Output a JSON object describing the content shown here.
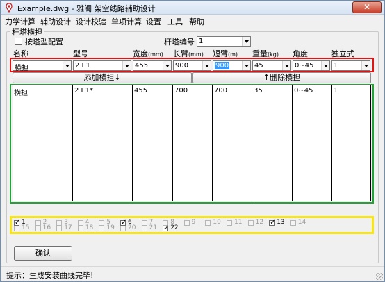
{
  "window": {
    "title": "Example.dwg - 雅阁 架空线路辅助设计",
    "close_label": "✕"
  },
  "menu": [
    "力学计算",
    "辅助设计",
    "设计校验",
    "单项计算",
    "设置",
    "工具",
    "帮助"
  ],
  "group": {
    "title": "杆塔横担",
    "by_tower_checkbox": "按塔型配置",
    "by_tower_checked": false,
    "tower_no_label": "杆塔编号",
    "tower_no_value": "1"
  },
  "columns": {
    "name": "名称",
    "model": "型号",
    "width": "宽度",
    "width_unit": "(mm)",
    "long_arm": "长臂",
    "long_arm_unit": "(mm)",
    "short_arm": "短臂",
    "short_arm_unit": "(m)",
    "weight": "重量",
    "weight_unit": "(kg)",
    "angle": "角度",
    "independent": "独立式"
  },
  "inputs": {
    "name": "横担",
    "model": "2 I 1",
    "width": "455",
    "long_arm": "900",
    "short_arm": "900",
    "weight": "45",
    "angle": "0~45",
    "independent": "1"
  },
  "buttons": {
    "add": "添加横担↓",
    "delete": "↑删除横担",
    "ok": "确认"
  },
  "table_rows": [
    [
      "横担",
      "2 I 1*",
      "455",
      "700",
      "700",
      "35",
      "0~45",
      "1"
    ]
  ],
  "numbers": [
    {
      "n": "1",
      "checked": true,
      "enabled": true
    },
    {
      "n": "2",
      "checked": false,
      "enabled": false
    },
    {
      "n": "3",
      "checked": false,
      "enabled": false
    },
    {
      "n": "4",
      "checked": false,
      "enabled": false
    },
    {
      "n": "5",
      "checked": false,
      "enabled": false
    },
    {
      "n": "6",
      "checked": true,
      "enabled": true
    },
    {
      "n": "7",
      "checked": false,
      "enabled": false
    },
    {
      "n": "8",
      "checked": false,
      "enabled": false
    },
    {
      "n": "9",
      "checked": false,
      "enabled": false
    },
    {
      "n": "10",
      "checked": false,
      "enabled": false
    },
    {
      "n": "11",
      "checked": false,
      "enabled": false
    },
    {
      "n": "12",
      "checked": false,
      "enabled": false
    },
    {
      "n": "13",
      "checked": true,
      "enabled": true
    },
    {
      "n": "14",
      "checked": false,
      "enabled": false
    },
    {
      "n": "15",
      "checked": false,
      "enabled": false
    },
    {
      "n": "16",
      "checked": false,
      "enabled": false
    },
    {
      "n": "17",
      "checked": false,
      "enabled": false
    },
    {
      "n": "18",
      "checked": false,
      "enabled": false
    },
    {
      "n": "19",
      "checked": false,
      "enabled": false
    },
    {
      "n": "20",
      "checked": false,
      "enabled": false
    },
    {
      "n": "21",
      "checked": false,
      "enabled": false
    },
    {
      "n": "22",
      "checked": true,
      "enabled": true
    }
  ],
  "status": "提示：生成安装曲线完毕!",
  "colors": {
    "red_frame": "#e01414",
    "green_frame": "#22a338",
    "yellow_frame": "#f7e516",
    "selection": "#3399ff"
  }
}
